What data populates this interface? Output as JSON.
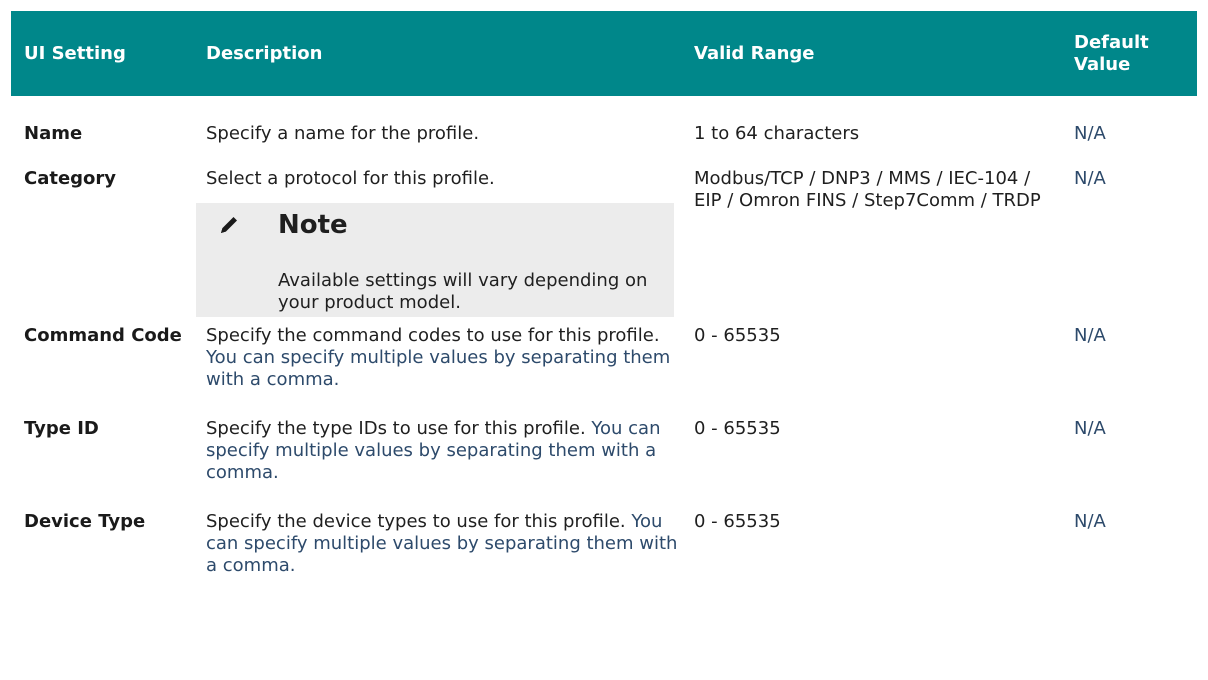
{
  "table": {
    "headers": [
      "UI Setting",
      "Description",
      "Valid Range",
      "Default Value"
    ],
    "rows": [
      {
        "setting": "Name",
        "description": "Specify a name for the profile.",
        "description_extra": "",
        "range": "1 to 64 characters",
        "default": "N/A"
      },
      {
        "setting": "Category",
        "description": "Select a protocol for this profile.",
        "description_extra": "",
        "range": "Modbus/TCP / DNP3 / MMS / IEC-104 / EIP / Omron FINS / Step7Comm / TRDP",
        "default": "N/A"
      },
      {
        "setting": "Command Code",
        "description": "Specify the command codes to use for this profile.",
        "description_extra": "You can specify multiple values by separating them with a comma.",
        "range": "0 - 65535",
        "default": "N/A"
      },
      {
        "setting": "Type ID",
        "description": "Specify the type IDs to use for this profile.",
        "description_extra": "You can specify multiple values by separating them with a comma.",
        "range": "0 - 65535",
        "default": "N/A"
      },
      {
        "setting": "Device Type",
        "description": "Specify the device types to use for this profile.",
        "description_extra": "You can specify multiple values by separating them with a comma.",
        "range": "0 - 65535",
        "default": "N/A"
      }
    ]
  },
  "note": {
    "icon": "pencil-icon",
    "title": "Note",
    "body": "Available settings will vary depending on your product model."
  },
  "colors": {
    "header_bg": "#00878a",
    "header_text": "#ffffff",
    "note_bg": "#ececec",
    "accent_text": "#2d4a6b"
  }
}
